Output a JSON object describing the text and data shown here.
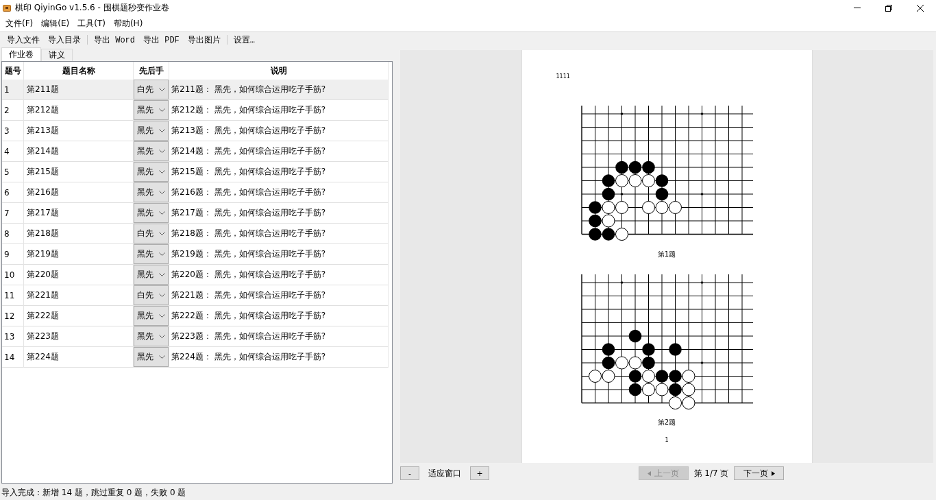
{
  "window": {
    "title": "棋印 QiyinGo v1.5.6 - 围棋题秒变作业卷"
  },
  "menu": [
    {
      "label": "文件(F)"
    },
    {
      "label": "编辑(E)"
    },
    {
      "label": "工具(T)"
    },
    {
      "label": "帮助(H)"
    }
  ],
  "toolbar": [
    [
      "导入文件",
      "导入目录"
    ],
    [
      "导出 Word",
      "导出 PDF",
      "导出图片"
    ],
    [
      "设置…"
    ]
  ],
  "tabs": [
    {
      "label": "作业卷",
      "selected": true
    },
    {
      "label": "讲义",
      "selected": false
    }
  ],
  "table": {
    "columns": [
      "题号",
      "题目名称",
      "先后手",
      "说明"
    ],
    "rows": [
      {
        "no": "1",
        "name": "第211题",
        "order": "白先",
        "note": "第211题： 黑先，如何综合运用吃子手筋?",
        "selected": true
      },
      {
        "no": "2",
        "name": "第212题",
        "order": "黑先",
        "note": "第212题： 黑先，如何综合运用吃子手筋?",
        "selected": false
      },
      {
        "no": "3",
        "name": "第213题",
        "order": "黑先",
        "note": "第213题： 黑先，如何综合运用吃子手筋?",
        "selected": false
      },
      {
        "no": "4",
        "name": "第214题",
        "order": "黑先",
        "note": "第214题： 黑先，如何综合运用吃子手筋?",
        "selected": false
      },
      {
        "no": "5",
        "name": "第215题",
        "order": "黑先",
        "note": "第215题： 黑先，如何综合运用吃子手筋?",
        "selected": false
      },
      {
        "no": "6",
        "name": "第216题",
        "order": "黑先",
        "note": "第216题： 黑先，如何综合运用吃子手筋?",
        "selected": false
      },
      {
        "no": "7",
        "name": "第217题",
        "order": "黑先",
        "note": "第217题： 黑先，如何综合运用吃子手筋?",
        "selected": false
      },
      {
        "no": "8",
        "name": "第218题",
        "order": "白先",
        "note": "第218题： 黑先，如何综合运用吃子手筋?",
        "selected": false
      },
      {
        "no": "9",
        "name": "第219题",
        "order": "黑先",
        "note": "第219题： 黑先，如何综合运用吃子手筋?",
        "selected": false
      },
      {
        "no": "10",
        "name": "第220题",
        "order": "黑先",
        "note": "第220题： 黑先，如何综合运用吃子手筋?",
        "selected": false
      },
      {
        "no": "11",
        "name": "第221题",
        "order": "白先",
        "note": "第221题： 黑先，如何综合运用吃子手筋?",
        "selected": false
      },
      {
        "no": "12",
        "name": "第222题",
        "order": "黑先",
        "note": "第222题： 黑先，如何综合运用吃子手筋?",
        "selected": false
      },
      {
        "no": "13",
        "name": "第223题",
        "order": "黑先",
        "note": "第223题： 黑先，如何综合运用吃子手筋?",
        "selected": false
      },
      {
        "no": "14",
        "name": "第224题",
        "order": "黑先",
        "note": "第224题： 黑先，如何综合运用吃子手筋?",
        "selected": false
      }
    ]
  },
  "preview": {
    "page": {
      "header": "1111",
      "page_number": "1",
      "problems": [
        {
          "caption": "第1题"
        },
        {
          "caption": "第2题"
        }
      ]
    },
    "controls": {
      "zoom_out": "-",
      "fit": "适应窗口",
      "zoom_in": "+",
      "prev": {
        "label": "上一页",
        "disabled": true
      },
      "page_info": "第 1/7 页",
      "next": {
        "label": "下一页",
        "disabled": false
      }
    }
  },
  "status_bar": "导入完成：新增 14 题，跳过重复 0 题，失败 0 题"
}
